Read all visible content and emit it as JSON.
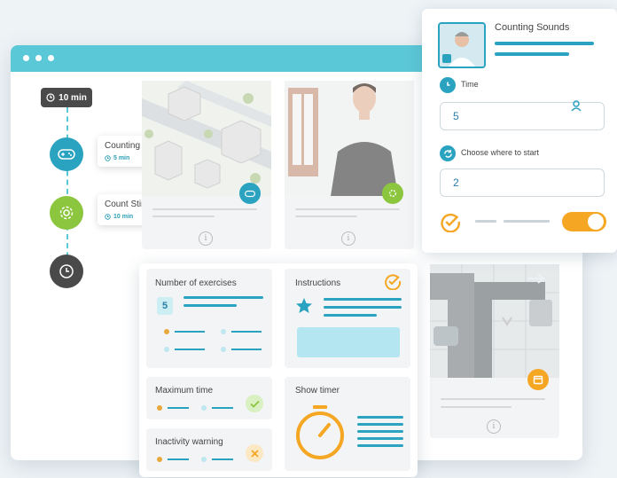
{
  "timeline": {
    "duration_badge": "10 min",
    "items": [
      {
        "label": "Counting sounds",
        "duration": "5 min"
      },
      {
        "label": "Count Stimuli by Type",
        "duration": "10 min"
      }
    ]
  },
  "options_panel": {
    "number_of_exercises": {
      "label": "Number of exercises",
      "value": "5"
    },
    "instructions": {
      "label": "Instructions"
    },
    "maximum_time": {
      "label": "Maximum time"
    },
    "show_timer": {
      "label": "Show timer"
    },
    "inactivity_warning": {
      "label": "Inactivity warning"
    }
  },
  "settings_card": {
    "title": "Counting Sounds",
    "time": {
      "label": "Time",
      "value": "5"
    },
    "start": {
      "label": "Choose where to start",
      "value": "2"
    },
    "toggle_on": true
  },
  "colors": {
    "accent": "#2aa3c0",
    "green": "#8cc63f",
    "orange": "#f5a623",
    "dark": "#4a4a4a"
  },
  "info_glyph": "i"
}
